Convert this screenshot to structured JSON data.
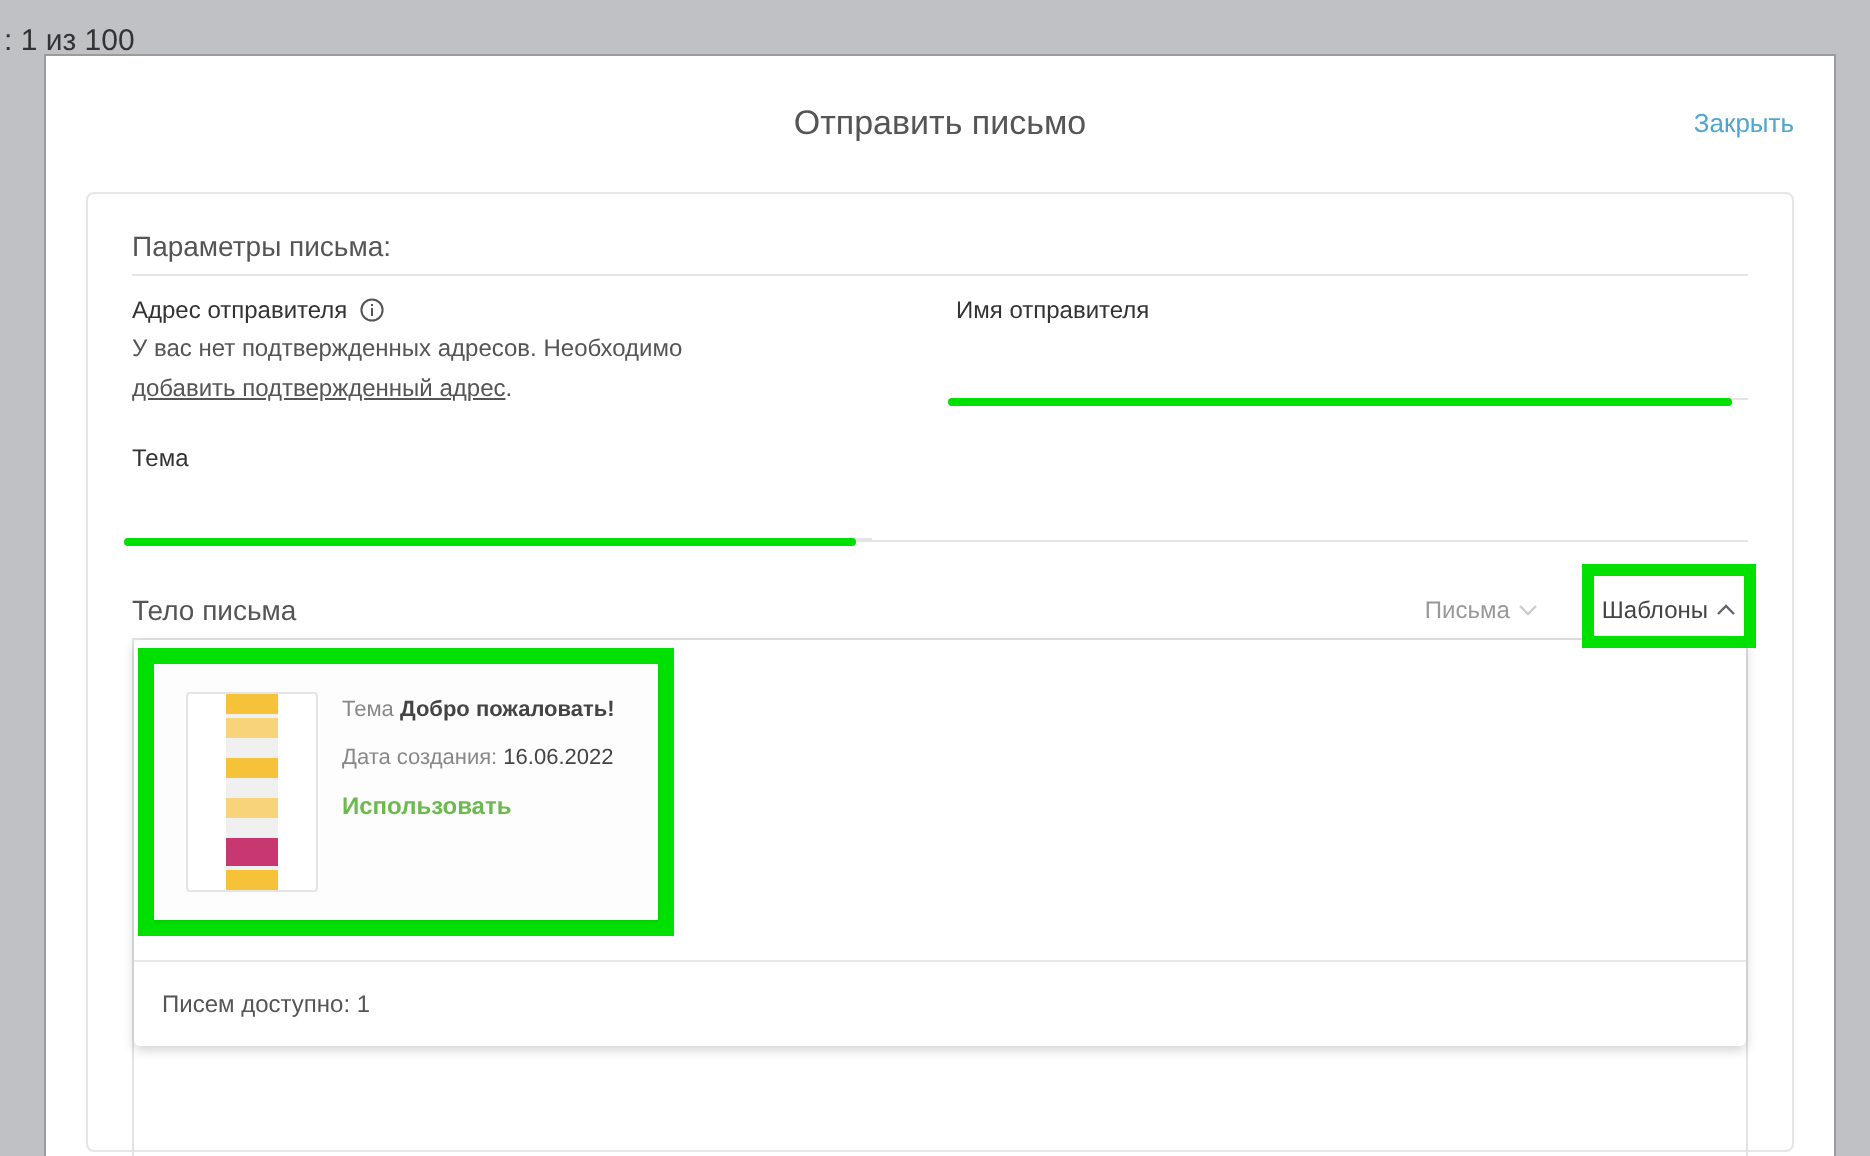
{
  "background": {
    "counter": ": 1 из 100"
  },
  "dialog": {
    "title": "Отправить письмо",
    "close": "Закрыть"
  },
  "params": {
    "heading": "Параметры письма:",
    "sender_address": {
      "label": "Адрес отправителя",
      "message_before": "У вас нет подтвержденных адресов. Необходимо",
      "link": "добавить подтвержденный адрес",
      "message_after": "."
    },
    "sender_name": {
      "label": "Имя отправителя"
    },
    "subject": {
      "label": "Тема"
    }
  },
  "body": {
    "label": "Тело письма",
    "dropdowns": [
      {
        "label": "Письма",
        "expanded": false
      },
      {
        "label": "Шаблоны",
        "expanded": true
      }
    ],
    "templates": [
      {
        "subject_label": "Тема",
        "subject": "Добро пожаловать!",
        "date_label": "Дата создания:",
        "date": "16.06.2022",
        "action": "Использовать"
      }
    ],
    "footer": "Писем доступно: 1"
  }
}
